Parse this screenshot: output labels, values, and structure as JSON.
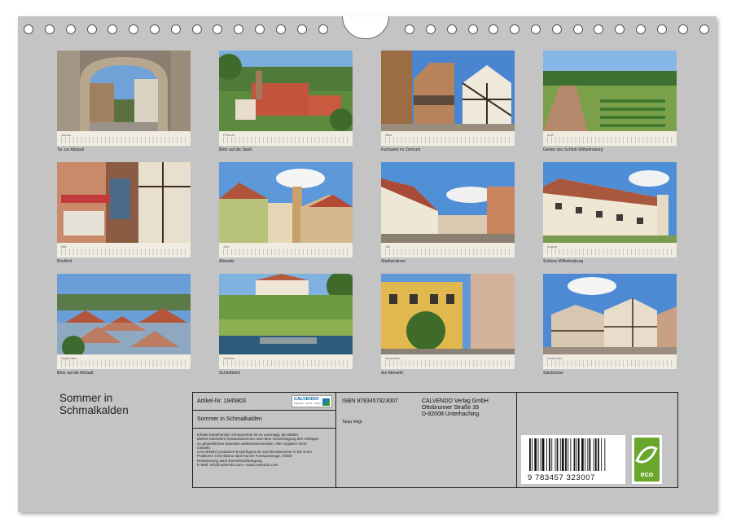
{
  "title": "Sommer in Schmalkalden",
  "title_lines": [
    "Sommer in",
    "Schmalkalden"
  ],
  "months": [
    {
      "month": "Januar",
      "caption": "Tor zur Altstadt"
    },
    {
      "month": "Februar",
      "caption": "Blick auf die Stadt"
    },
    {
      "month": "März",
      "caption": "Fachwerk im Zentrum"
    },
    {
      "month": "April",
      "caption": "Garten des Schloß Wilhelmsburg"
    },
    {
      "month": "Mai",
      "caption": "Kirchhof"
    },
    {
      "month": "Juni",
      "caption": "Altmarkt"
    },
    {
      "month": "Juli",
      "caption": "Stadtzentrum"
    },
    {
      "month": "August",
      "caption": "Schloss Wilhelmsburg"
    },
    {
      "month": "September",
      "caption": "Blick auf die Altstadt"
    },
    {
      "month": "Oktober",
      "caption": "Schloßteich"
    },
    {
      "month": "November",
      "caption": "Am Altmarkt"
    },
    {
      "month": "Dezember",
      "caption": "Salzbrücke"
    }
  ],
  "info": {
    "article": "Artikel-Nr. 1945803",
    "calvendo_logo": "CALVENDO",
    "calvendo_sub": "Kalender · Kunst · Kultur",
    "product_title": "Sommer in Schmalkalden",
    "legal_lines": [
      "Inhalte bestehender Schutzrechte ist es untersagt, die Blätter",
      "dieses Kalenders herauszutrennen und ohne Genehmigung des Verlages",
      "zu gewerblichen Zwecken weiterzuverwenden. Alle Angaben ohne",
      "Gewähr.",
      "CALVENDO produziert bedarfsgerecht und klimabewusst in DE & EU.",
      "Positivere CO2-Bilanz dank kurzer Transportwege. Abfall-",
      "Reduzierung dank Einzelstückfertigung.",
      "E-Mail: info@calvendo.com • www.calvendo.com"
    ],
    "isbn": "ISBN 9783457323007",
    "author": "Tanja Voigt",
    "publisher_lines": [
      "CALVENDO Verlag GmbH",
      "Ottobrunner Straße 39",
      "D-82008 Unterhaching"
    ],
    "barcode_number": "9 783457 323007",
    "eco_label": "eco"
  }
}
